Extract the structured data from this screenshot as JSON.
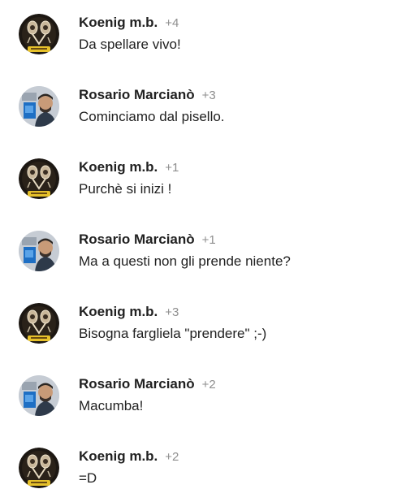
{
  "comments": [
    {
      "author": "Koenig m.b.",
      "plusones": "+4",
      "text": "Da spellare vivo!",
      "avatar": "koenig-avatar"
    },
    {
      "author": "Rosario Marcianò",
      "plusones": "+3",
      "text": "Cominciamo dal pisello.",
      "avatar": "rosario-avatar"
    },
    {
      "author": "Koenig m.b.",
      "plusones": "+1",
      "text": "Purchè si inizi !",
      "avatar": "koenig-avatar"
    },
    {
      "author": "Rosario Marcianò",
      "plusones": "+1",
      "text": "Ma a questi non gli prende niente?",
      "avatar": "rosario-avatar"
    },
    {
      "author": "Koenig m.b.",
      "plusones": "+3",
      "text": "Bisogna fargliela \"prendere\" ;-)",
      "avatar": "koenig-avatar"
    },
    {
      "author": "Rosario Marcianò",
      "plusones": "+2",
      "text": "Macumba!",
      "avatar": "rosario-avatar"
    },
    {
      "author": "Koenig m.b.",
      "plusones": "+2",
      "text": "=D",
      "avatar": "koenig-avatar"
    }
  ],
  "colors": {
    "author": "#212121",
    "plusones": "#8e8e8e",
    "text": "#212121",
    "background": "#ffffff"
  }
}
